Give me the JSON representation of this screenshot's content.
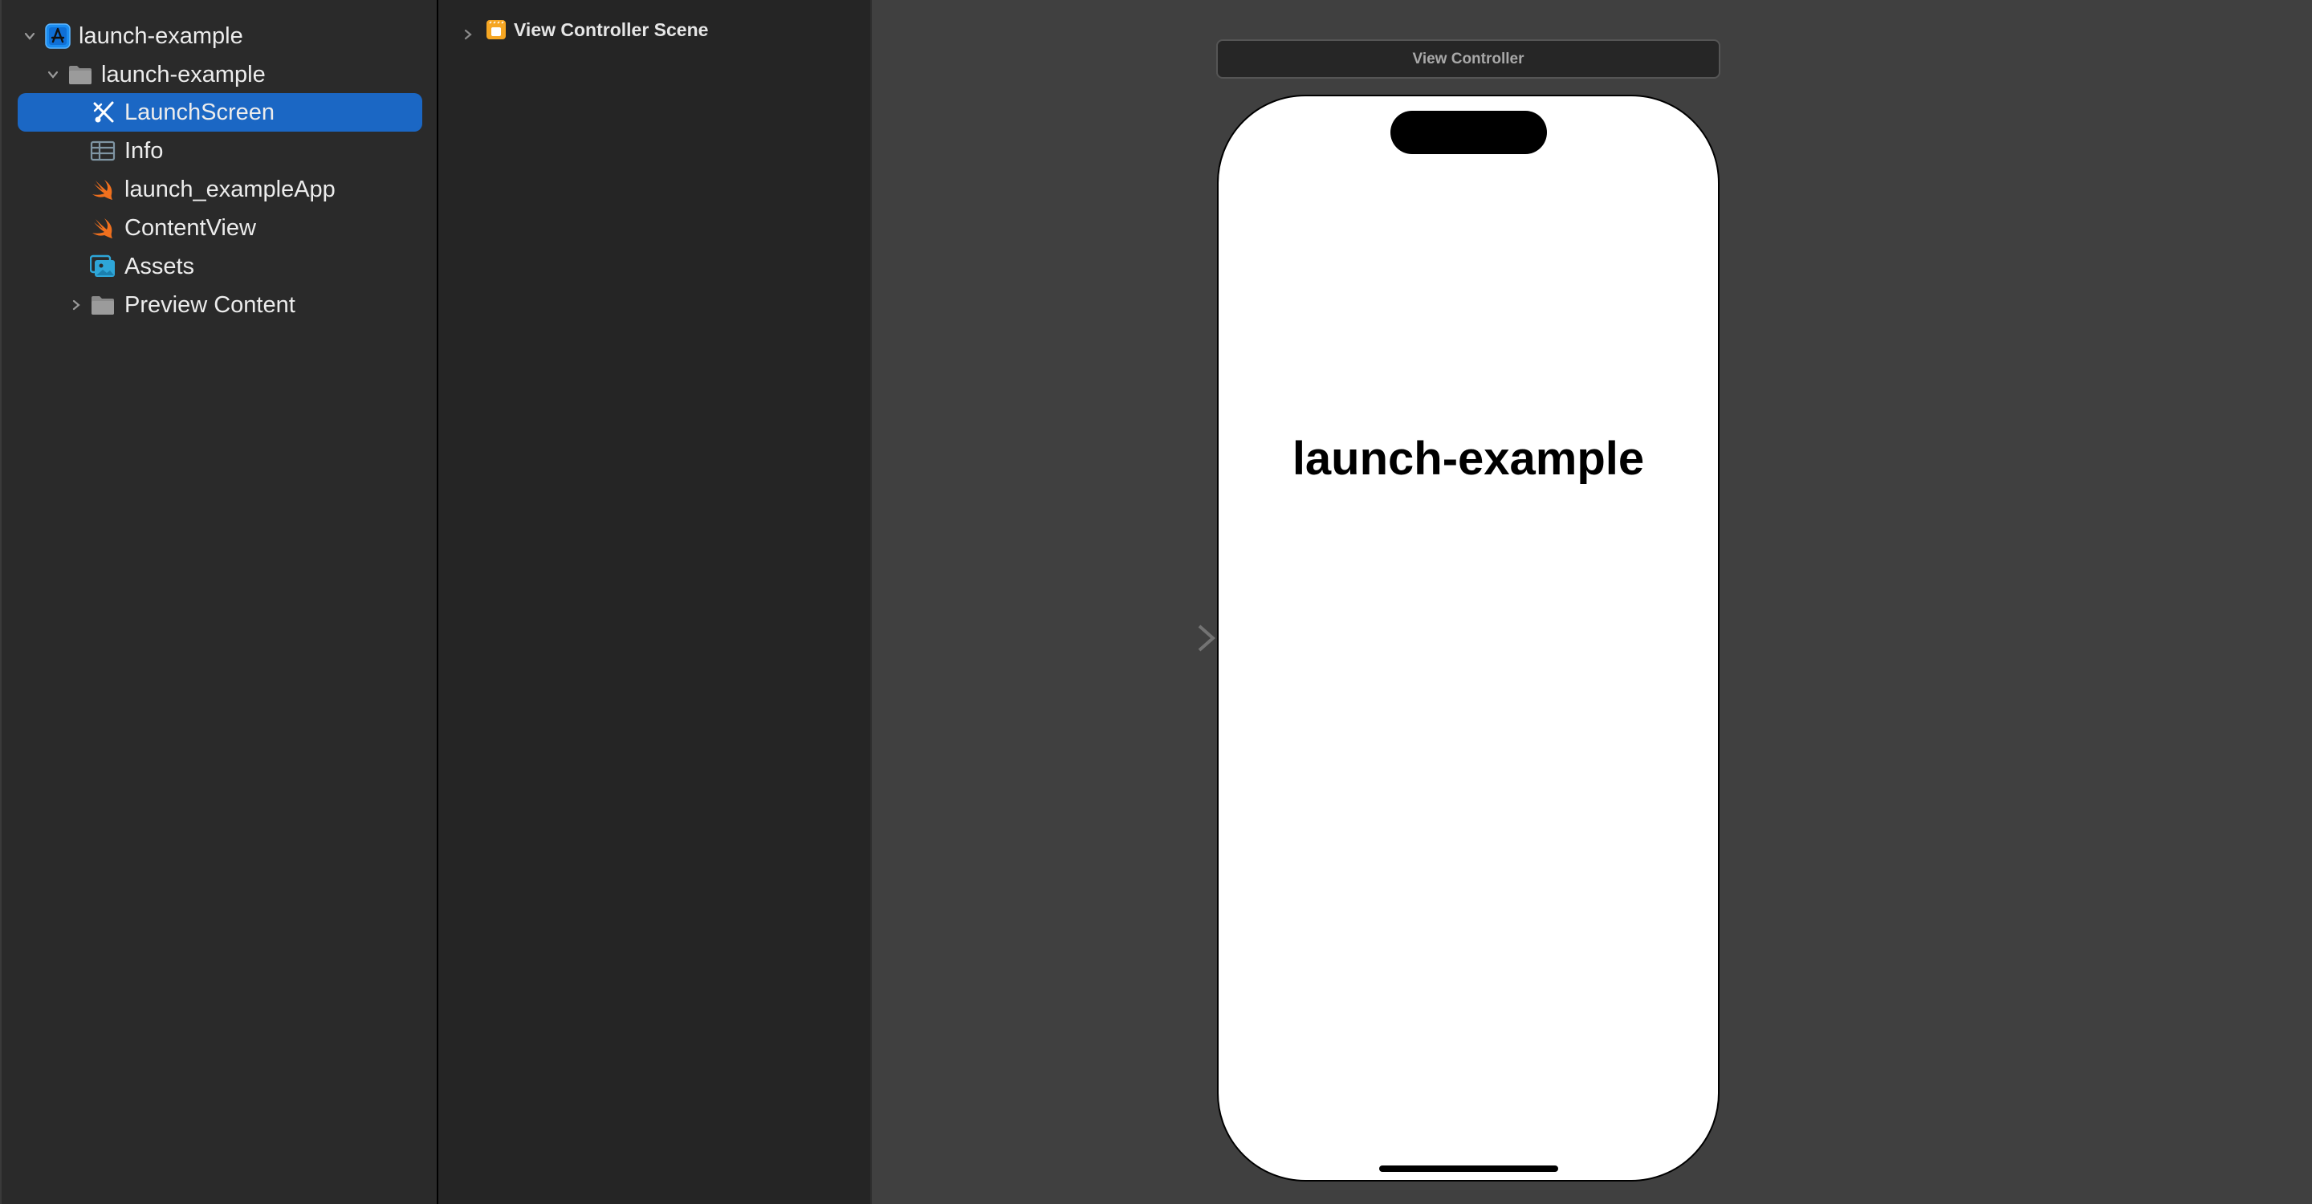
{
  "navigator": {
    "items": [
      {
        "label": "launch-example",
        "icon": "xcode-project-icon",
        "level": 0,
        "disclosure": "expanded"
      },
      {
        "label": "launch-example",
        "icon": "folder-icon",
        "level": 1,
        "disclosure": "expanded"
      },
      {
        "label": "LaunchScreen",
        "icon": "storyboard-icon",
        "level": 2,
        "selected": true
      },
      {
        "label": "Info",
        "icon": "plist-table-icon",
        "level": 2
      },
      {
        "label": "launch_exampleApp",
        "icon": "swift-icon",
        "level": 2
      },
      {
        "label": "ContentView",
        "icon": "swift-icon",
        "level": 2
      },
      {
        "label": "Assets",
        "icon": "asset-catalog-icon",
        "level": 2
      },
      {
        "label": "Preview Content",
        "icon": "folder-icon",
        "level": 2,
        "disclosure": "collapsed"
      }
    ],
    "selection_color": "#1b67c4"
  },
  "document_outline": {
    "items": [
      {
        "label": "View Controller Scene",
        "icon": "scene-icon",
        "disclosure": "collapsed"
      }
    ]
  },
  "canvas": {
    "scene_header": "View Controller",
    "device_label": "launch-example",
    "initial_view_controller_arrow": true
  },
  "colors": {
    "swift": "#f0701e",
    "project": "#1a8cf0",
    "assets": "#2ea6d8",
    "scene": "#f5a623"
  }
}
